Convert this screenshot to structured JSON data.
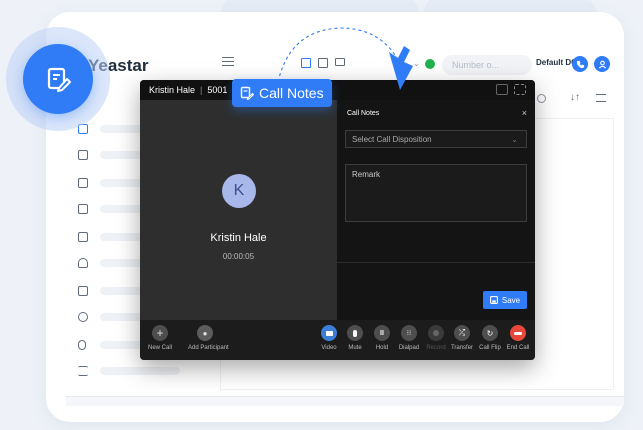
{
  "brand": {
    "name": "Yeastar"
  },
  "callout": {
    "label": "Call Notes"
  },
  "topbar": {
    "search_placeholder": "Number o...",
    "dod_label": "Default DOD"
  },
  "call": {
    "contact_name": "Kristin Hale",
    "extension": "5001",
    "avatar_initial": "K",
    "duration": "00:00:05"
  },
  "notes_panel": {
    "title": "Call Notes",
    "close_glyph": "×",
    "disposition_placeholder": "Select Call Disposition",
    "remark_placeholder": "Remark",
    "save_label": "Save"
  },
  "toolbar": {
    "new_call": "New Call",
    "add_participant": "Add Participant",
    "video": "Video",
    "mute": "Mute",
    "hold": "Hold",
    "dialpad": "Dialpad",
    "record": "Record",
    "transfer": "Transfer",
    "call_flip": "Call Flip",
    "end_call": "End Call"
  },
  "colors": {
    "accent": "#2f7cf6",
    "end_call": "#e8483b",
    "online": "#22b14c"
  },
  "icons": {
    "app": "notes-edit-icon",
    "sidebar": [
      "dashboard-icon",
      "message-icon",
      "home-icon",
      "contact-card-icon",
      "monitor-icon",
      "headset-icon",
      "document-icon",
      "voicemail-icon",
      "microphone-icon",
      "settings-list-icon"
    ]
  }
}
